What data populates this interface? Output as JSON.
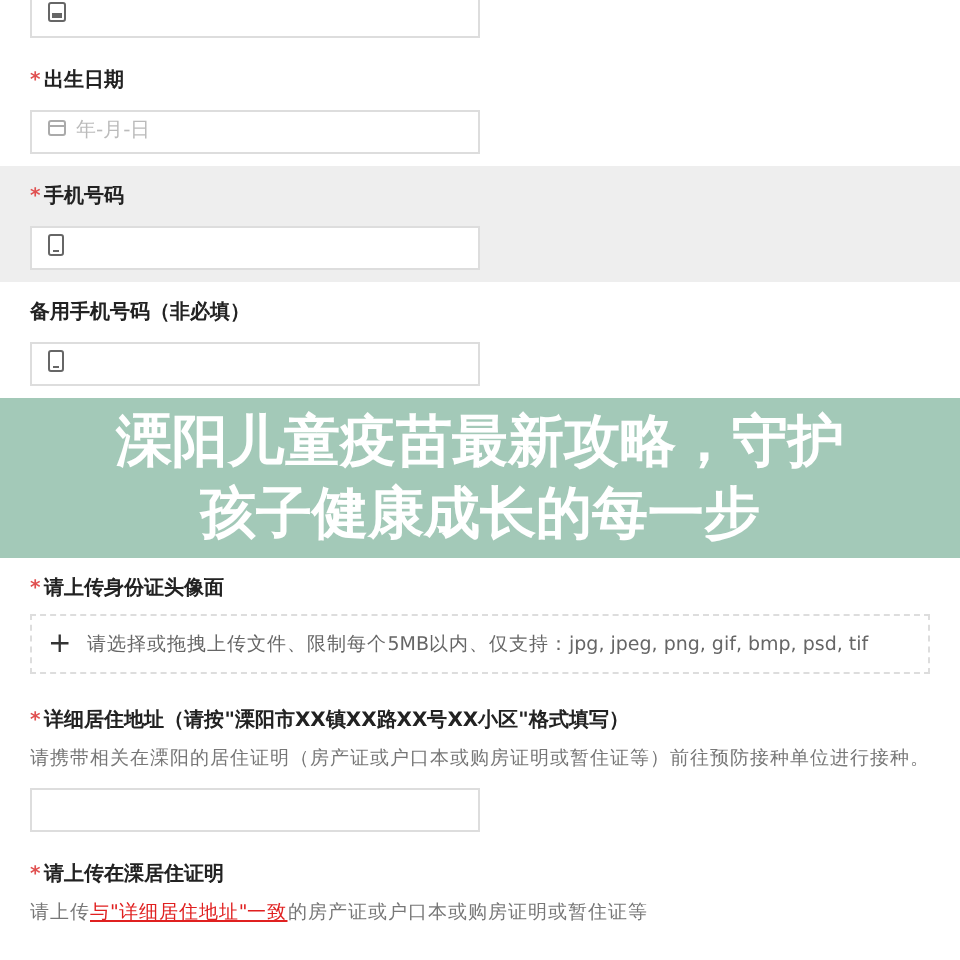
{
  "fields": [
    {
      "kind": "id-input"
    },
    {
      "kind": "date-input",
      "mark": "*",
      "label": "出生日期",
      "placeholder": "年-月-日"
    },
    {
      "kind": "phone-input",
      "mark": "*",
      "label": "手机号码",
      "highlighted": true
    },
    {
      "kind": "phone-input",
      "label": "备用手机号码（非必填）"
    },
    {
      "kind": "banner",
      "lines": [
        "溧阳儿童疫苗最新攻略，守护",
        "孩子健康成长的每一步"
      ]
    },
    {
      "kind": "upload",
      "mark": "*",
      "label": "请上传身份证头像面",
      "plus": "+",
      "upload_text": "请选择或拖拽上传文件、限制每个5MB以内、仅支持：jpg, jpeg, png, gif, bmp, psd, tif"
    },
    {
      "kind": "plain-input",
      "mark": "*",
      "label": "详细居住地址（请按\"溧阳市XX镇XX路XX号XX小区\"格式填写）",
      "hint": [
        {
          "text": "请携带相关在溧阳的居住证明（房产证或户口本或购房证明或暂住证等）前往预防接种单位进行接种。",
          "highlight": false
        }
      ]
    },
    {
      "kind": "note",
      "mark": "*",
      "label": "请上传在溧居住证明",
      "hint": [
        {
          "text": "请上传",
          "highlight": false
        },
        {
          "text": "与\"详细居住地址\"一致",
          "highlight": true
        },
        {
          "text": "的房产证或户口本或购房证明或暂住证等",
          "highlight": false
        }
      ]
    }
  ]
}
